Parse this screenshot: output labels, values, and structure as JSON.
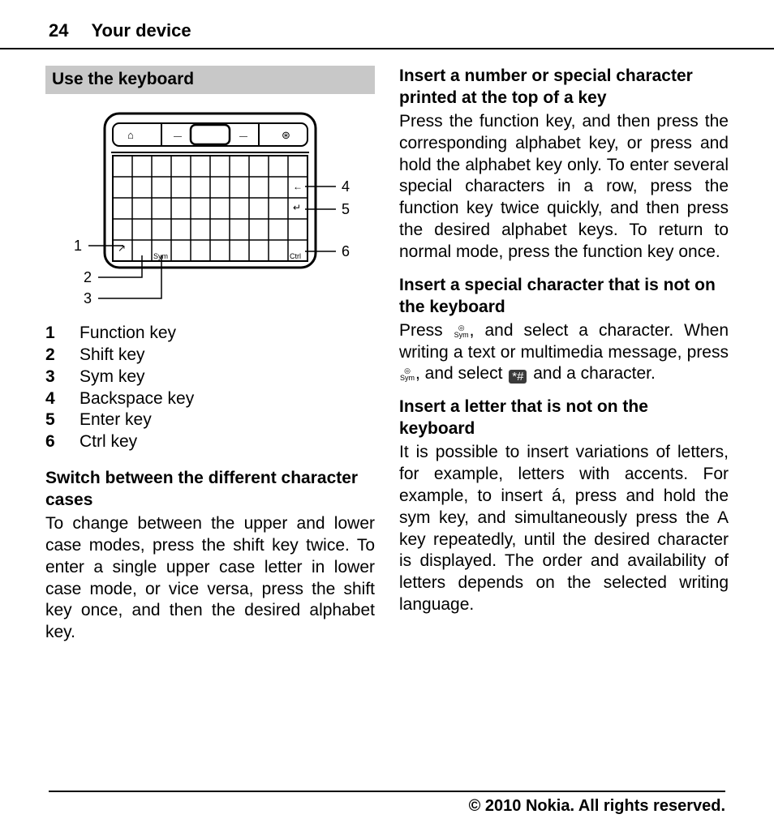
{
  "header": {
    "page_number": "24",
    "chapter": "Your device"
  },
  "left": {
    "section_title": "Use the keyboard",
    "diagram_labels": {
      "n1": "1",
      "n2": "2",
      "n3": "3",
      "n4": "4",
      "n5": "5",
      "n6": "6",
      "sym": "Sym",
      "ctrl": "Ctrl",
      "arrow_icon": "↗",
      "back_icon": "←",
      "enter_icon": "↵"
    },
    "legend": {
      "1": {
        "num": "1",
        "text": "Function key"
      },
      "2": {
        "num": "2",
        "text": "Shift key"
      },
      "3": {
        "num": "3",
        "text": "Sym key"
      },
      "4": {
        "num": "4",
        "text": "Backspace key"
      },
      "5": {
        "num": "5",
        "text": "Enter key"
      },
      "6": {
        "num": "6",
        "text": "Ctrl key"
      }
    },
    "sub1": "Switch between the different character cases",
    "para1": "To change between the upper and lower case modes, press the shift key twice. To enter a single upper case letter in lower case mode, or vice versa, press the shift key once, and then the desired alphabet key."
  },
  "right": {
    "sub1": "Insert a number or special character printed at the top of a key",
    "para1": "Press the function key, and then press the corresponding alphabet key, or press and hold the alphabet key only. To enter several special characters in a row, press the function key twice quickly, and then press the desired alphabet keys. To return to normal mode, press the function key once.",
    "sub2": "Insert a special character that is not on the keyboard",
    "para2a": "Press ",
    "para2b": ", and select a character. When writing a text or multimedia message, press ",
    "para2c": ", and select ",
    "para2d": " and a character.",
    "sym_top": "◎",
    "sym_bot": "Sym",
    "star_hash": "*#",
    "sub3": "Insert a letter that is not on the keyboard",
    "para3": "It is possible to insert variations of letters, for example, letters with accents. For example, to insert á, press and hold the sym key, and simultaneously press the A key repeatedly, until the desired character is displayed. The order and availability of letters depends on the selected writing language."
  },
  "footer": "© 2010 Nokia. All rights reserved."
}
